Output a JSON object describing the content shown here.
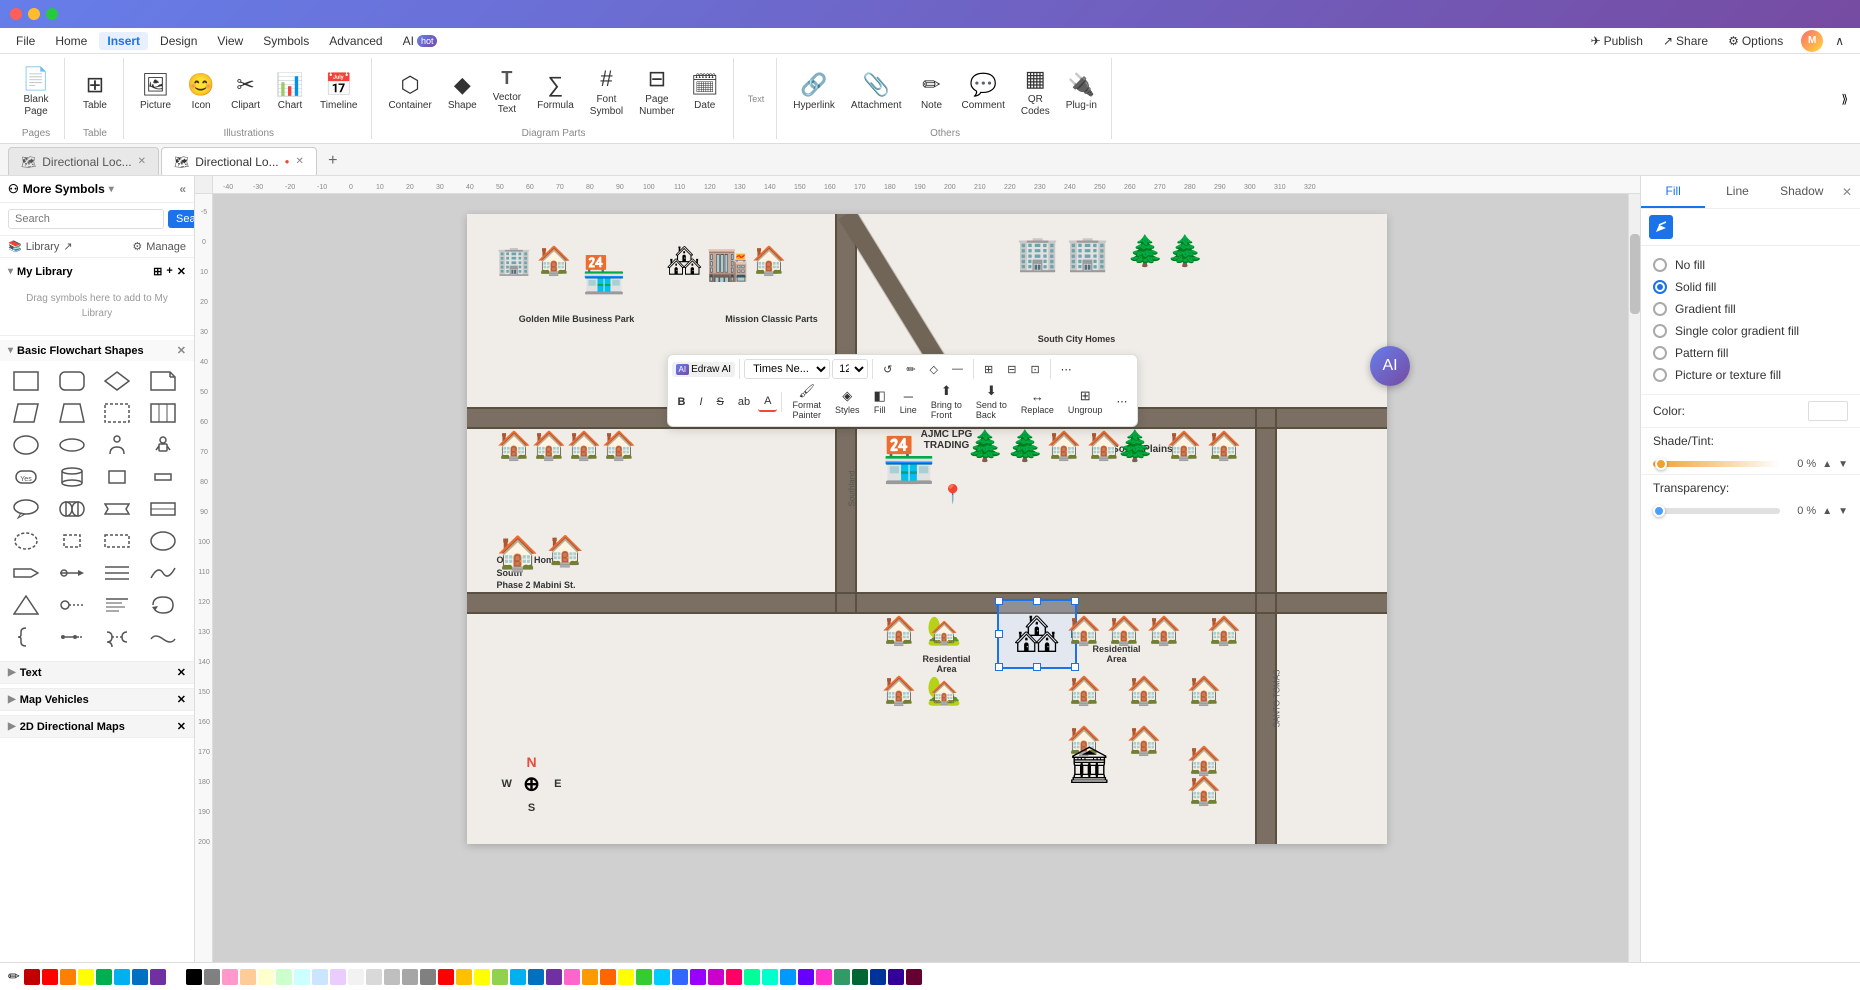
{
  "titleBar": {
    "dots": [
      "red",
      "yellow",
      "green"
    ]
  },
  "menuBar": {
    "items": [
      {
        "label": "File",
        "active": false
      },
      {
        "label": "Home",
        "active": false
      },
      {
        "label": "Insert",
        "active": true
      },
      {
        "label": "Design",
        "active": false
      },
      {
        "label": "View",
        "active": false
      },
      {
        "label": "Symbols",
        "active": false
      },
      {
        "label": "Advanced",
        "active": false
      },
      {
        "label": "AI",
        "active": false,
        "badge": "hot"
      }
    ],
    "rightActions": [
      "Publish",
      "Share",
      "Options"
    ]
  },
  "ribbon": {
    "groups": [
      {
        "label": "Pages",
        "items": [
          {
            "icon": "📄",
            "label": "Blank\nPage"
          }
        ]
      },
      {
        "label": "Table",
        "items": [
          {
            "icon": "⊞",
            "label": "Table"
          }
        ]
      },
      {
        "label": "Illustrations",
        "items": [
          {
            "icon": "🖼",
            "label": "Picture"
          },
          {
            "icon": "🔣",
            "label": "Icon"
          },
          {
            "icon": "✂",
            "label": "Clipart"
          },
          {
            "icon": "📊",
            "label": "Chart"
          },
          {
            "icon": "📅",
            "label": "Timeline"
          }
        ]
      },
      {
        "label": "Diagram Parts",
        "items": [
          {
            "icon": "⬡",
            "label": "Container"
          },
          {
            "icon": "◆",
            "label": "Shape"
          },
          {
            "icon": "T",
            "label": "Vector\nText"
          },
          {
            "icon": "∑",
            "label": "Formula"
          },
          {
            "icon": "#",
            "label": "Font\nSymbol"
          },
          {
            "icon": "⊟",
            "label": "Page\nNumber"
          },
          {
            "icon": "📅",
            "label": "Date"
          }
        ]
      },
      {
        "label": "Others",
        "items": [
          {
            "icon": "🔗",
            "label": "Hyperlink"
          },
          {
            "icon": "📎",
            "label": "Attachment"
          },
          {
            "icon": "✏",
            "label": "Note"
          },
          {
            "icon": "💬",
            "label": "Comment"
          },
          {
            "icon": "⊞",
            "label": "QR\nCodes"
          },
          {
            "icon": "🔌",
            "label": "Plug-in"
          }
        ]
      }
    ]
  },
  "tabs": [
    {
      "label": "Directional Loc...",
      "active": false,
      "closable": true,
      "icon": "🗺"
    },
    {
      "label": "Directional Lo...",
      "active": true,
      "closable": true,
      "icon": "🗺",
      "modified": true
    },
    {
      "label": "+",
      "isAdd": true
    }
  ],
  "sidebar": {
    "title": "More Symbols",
    "searchPlaceholder": "Search",
    "searchBtn": "Search",
    "library": "Library",
    "manage": "Manage",
    "myLibrary": "My Library",
    "libraryPlaceholder": "Drag symbols\nhere to add to\nMy Library",
    "basicFlowchart": "Basic Flowchart Shapes",
    "textSection": "Text",
    "mapVehicles": "Map Vehicles",
    "directionalMaps": "2D Directional Maps"
  },
  "canvas": {
    "mapElements": {
      "title1": "Golden Mile Business Park",
      "title2": "Mission Classic Parts",
      "title3": "South City Homes",
      "title4": "AJMC LPG\nTRADING",
      "title5": "South Plains II",
      "title6": "Olivarez Homes\nSouth\nPhase 2 Mabini St.",
      "title7": "Residential\nArea",
      "title8": "Residential\nArea",
      "street1": "Southland",
      "street2": "SANTO TOMAS"
    }
  },
  "floatingToolbar": {
    "font": "Times Ne...",
    "size": "12",
    "actions": [
      "B",
      "I",
      "≡",
      "ab",
      "A"
    ],
    "tools": [
      "Format\nPainter",
      "Styles",
      "Fill",
      "Line",
      "Bring to\nFront",
      "Send to\nBack",
      "Replace",
      "Ungroup"
    ]
  },
  "rightPanel": {
    "tabs": [
      "Fill",
      "Line",
      "Shadow"
    ],
    "fillOptions": [
      {
        "label": "No fill",
        "checked": false
      },
      {
        "label": "Solid fill",
        "checked": true
      },
      {
        "label": "Gradient fill",
        "checked": false
      },
      {
        "label": "Single color gradient fill",
        "checked": false
      },
      {
        "label": "Pattern fill",
        "checked": false
      },
      {
        "label": "Picture or texture fill",
        "checked": false
      }
    ],
    "colorLabel": "Color:",
    "shadeTintLabel": "Shade/Tint:",
    "shadePct": "0 %",
    "transparencyLabel": "Transparency:",
    "transparencyPct": "0 %"
  },
  "bottomBar": {
    "drawIcon": "✏",
    "colors": [
      "#c00000",
      "#ff0000",
      "#ff7f00",
      "#ffff00",
      "#00b050",
      "#00b0f0",
      "#0070c0",
      "#7030a0",
      "#ffffff",
      "#000000",
      "#808080",
      "#ff99cc",
      "#ffcc99",
      "#ffffcc",
      "#ccffcc",
      "#ccffff",
      "#cce5ff",
      "#ebccff",
      "#f2f2f2",
      "#d9d9d9",
      "#bfbfbf",
      "#a6a6a6",
      "#808080",
      "#ff0000",
      "#ffc000",
      "#ffff00",
      "#92d050",
      "#00b0f0",
      "#0070c0",
      "#7030a0",
      "#ff66cc",
      "#ff9900",
      "#ff6600",
      "#ffff00",
      "#33cc33",
      "#00ccff",
      "#3366ff",
      "#9900ff",
      "#cc00cc",
      "#ff0066",
      "#00ff99",
      "#00ffcc",
      "#0099ff",
      "#6600ff",
      "#ff33cc",
      "#339966",
      "#006633",
      "#003399",
      "#330099",
      "#660033"
    ]
  }
}
